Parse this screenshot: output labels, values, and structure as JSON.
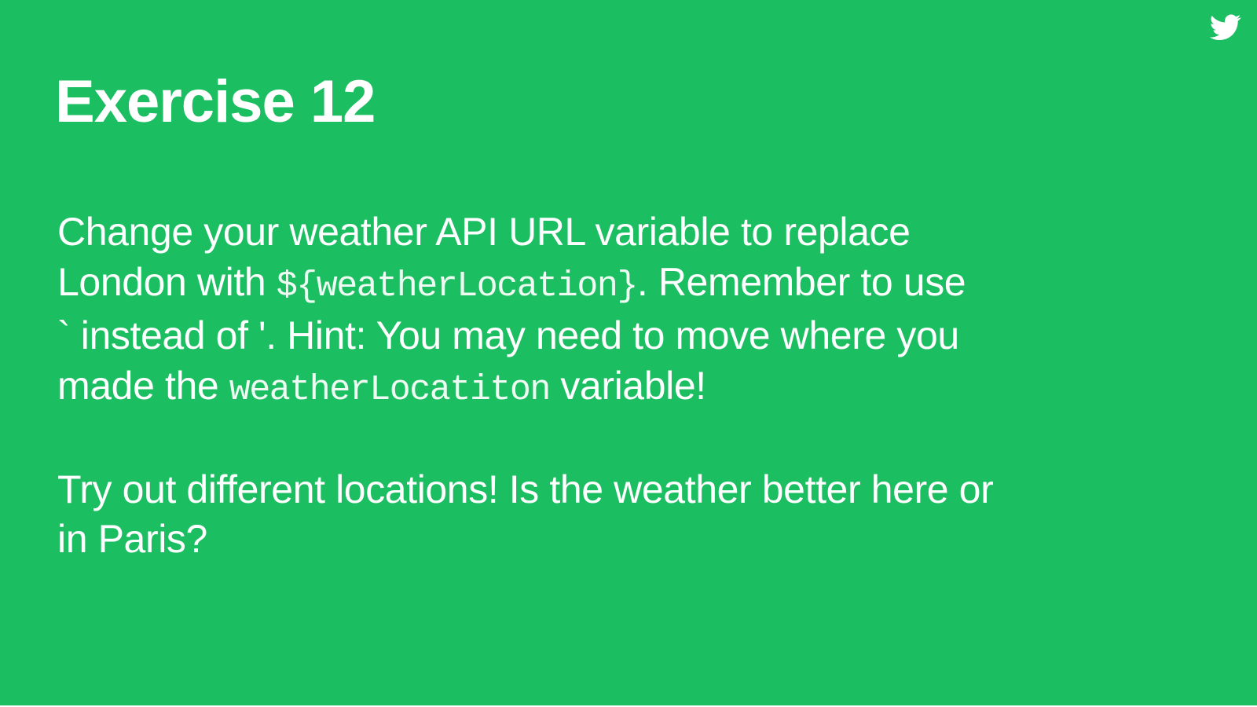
{
  "slide": {
    "background_color": "#1bbf61",
    "text_color": "#ffffff",
    "logo_icon": "twitter-bird-icon",
    "title": "Exercise 12",
    "paragraph1": {
      "line1": "Change your weather API URL variable to replace",
      "line2_before": "London with ",
      "line2_code": "${weatherLocation}",
      "line2_after": ". Remember to use",
      "line3": "` instead of '. Hint: You may need to move where you",
      "line4_before": "made the ",
      "line4_code": "weatherLocatiton",
      "line4_after": " variable!"
    },
    "paragraph2": {
      "line1": "Try out different locations! Is the weather better here or",
      "line2": "in Paris?"
    }
  }
}
